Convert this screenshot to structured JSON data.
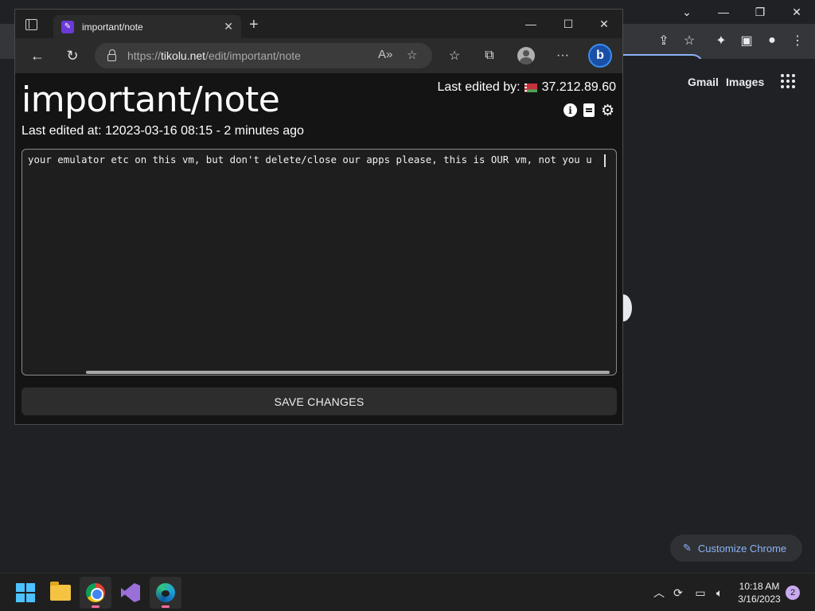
{
  "background_chrome": {
    "links": {
      "gmail": "Gmail",
      "images": "Images"
    },
    "customize_label": "Customize Chrome",
    "accent_color": "#8ab4f8"
  },
  "edge": {
    "tab_title": "important/note",
    "url_prefix": "https://",
    "url_host": "tikolu.net",
    "url_path": "/edit/important/note"
  },
  "note": {
    "title": "important/note",
    "last_edited_by_label": "Last edited by:",
    "last_edited_by_ip": "37.212.89.60",
    "last_edited_at": "Last edited at: 12023-03-16  08:15 - 2 minutes ago",
    "content": "your emulator etc on this vm, but don't delete/close our apps please, this is OUR vm, not you u",
    "save_label": "SAVE CHANGES"
  },
  "taskbar": {
    "time": "10:18 AM",
    "date": "3/16/2023",
    "notification_count": "2",
    "apps": [
      "start",
      "file-explorer",
      "chrome",
      "visual-studio",
      "edge"
    ]
  }
}
